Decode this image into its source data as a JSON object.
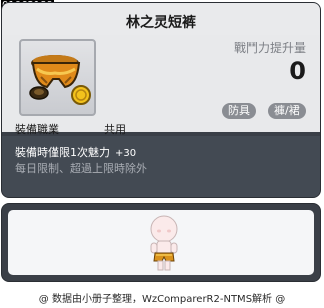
{
  "item": {
    "id": "01062189",
    "name": "林之灵短裤",
    "icon": "shorts-icon"
  },
  "stats": {
    "attack_increase_label": "戰鬥力提升量",
    "attack_increase_value": "0"
  },
  "tags": [
    "防具",
    "褲/裙"
  ],
  "job": {
    "label": "裝備職業",
    "value": "共用"
  },
  "description": {
    "line1": "裝備時僅限1次魅力",
    "line1_bonus": "+30",
    "line2": "每日限制、超過上限時除外"
  },
  "credits": "@ 数据由小册子整理，WzComparerR2-NTMS解析 @",
  "colors": {
    "panel_bg": "#3a3f47",
    "title_bar": "#e9eaec",
    "tag_bg": "#8a8d93",
    "accent_gold": "#f0a020"
  }
}
